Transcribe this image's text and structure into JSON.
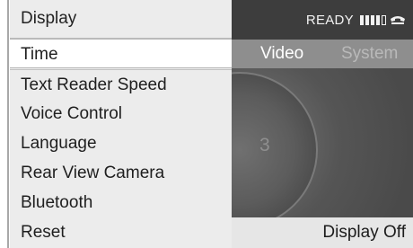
{
  "menu": {
    "header": "Display",
    "items": [
      {
        "label": "Time",
        "selected": true
      },
      {
        "label": "Text Reader Speed",
        "selected": false
      },
      {
        "label": "Voice Control",
        "selected": false
      },
      {
        "label": "Language",
        "selected": false
      },
      {
        "label": "Rear View Camera",
        "selected": false
      },
      {
        "label": "Bluetooth",
        "selected": false
      },
      {
        "label": "Reset",
        "selected": false
      }
    ]
  },
  "status": {
    "ready": "READY",
    "signal_bars_filled": 4,
    "signal_bars_total": 5,
    "phone_icon": "phone-handset-icon"
  },
  "tabs": {
    "video": "Video",
    "system": "System"
  },
  "background": {
    "dial_number": "3"
  },
  "bottom": {
    "display_off": "Display Off"
  },
  "colors": {
    "menu_bg": "#ececec",
    "selected_bg": "#ffffff",
    "status_bar": "#3d3d3d",
    "tabs_bar": "#8e8e8e"
  }
}
